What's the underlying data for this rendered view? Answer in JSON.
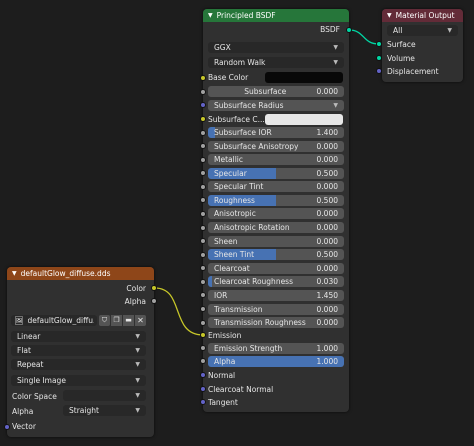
{
  "colors": {
    "bsdf_header": "#26763a",
    "output_header": "#632b38",
    "image_header": "#8e4619",
    "value_fill": "#4772b3"
  },
  "bsdf": {
    "title": "Principled BSDF",
    "output_label": "BSDF",
    "distribution": "GGX",
    "subsurface_method": "Random Walk",
    "base_color_label": "Base Color",
    "base_color_value": "#080808",
    "subsurface": {
      "label": "Subsurface",
      "value": "0.000"
    },
    "subsurface_radius_label": "Subsurface Radius",
    "subsurface_color": {
      "label": "Subsurface C...",
      "value": "#e8e8e8"
    },
    "params": [
      {
        "label": "Subsurface IOR",
        "value": "1.400",
        "fill": 0.05
      },
      {
        "label": "Subsurface Anisotropy",
        "value": "0.000",
        "fill": 0
      },
      {
        "label": "Metallic",
        "value": "0.000",
        "fill": 0
      },
      {
        "label": "Specular",
        "value": "0.500",
        "fill": 0.5
      },
      {
        "label": "Specular Tint",
        "value": "0.000",
        "fill": 0
      },
      {
        "label": "Roughness",
        "value": "0.500",
        "fill": 0.5
      },
      {
        "label": "Anisotropic",
        "value": "0.000",
        "fill": 0
      },
      {
        "label": "Anisotropic Rotation",
        "value": "0.000",
        "fill": 0
      },
      {
        "label": "Sheen",
        "value": "0.000",
        "fill": 0
      },
      {
        "label": "Sheen Tint",
        "value": "0.500",
        "fill": 0.5
      },
      {
        "label": "Clearcoat",
        "value": "0.000",
        "fill": 0
      },
      {
        "label": "Clearcoat Roughness",
        "value": "0.030",
        "fill": 0.03
      },
      {
        "label": "IOR",
        "value": "1.450",
        "fill": 0
      },
      {
        "label": "Transmission",
        "value": "0.000",
        "fill": 0
      },
      {
        "label": "Transmission Roughness",
        "value": "0.000",
        "fill": 0
      }
    ],
    "emission_label": "Emission",
    "emission_strength": {
      "label": "Emission Strength",
      "value": "1.000",
      "fill": 0
    },
    "alpha": {
      "label": "Alpha",
      "value": "1.000",
      "fill": 1
    },
    "normal_label": "Normal",
    "clearcoat_normal_label": "Clearcoat Normal",
    "tangent_label": "Tangent"
  },
  "material_output": {
    "title": "Material Output",
    "target": "All",
    "inputs": [
      "Surface",
      "Volume",
      "Displacement"
    ]
  },
  "image_node": {
    "title": "defaultGlow_diffuse.dds",
    "outputs": [
      "Color",
      "Alpha"
    ],
    "image_name": "defaultGlow_diffu...",
    "interpolation": "Linear",
    "projection": "Flat",
    "extension": "Repeat",
    "source": "Single Image",
    "color_space_label": "Color Space",
    "color_space_value": "",
    "alpha_label": "Alpha",
    "alpha_value": "Straight",
    "vector_label": "Vector"
  }
}
